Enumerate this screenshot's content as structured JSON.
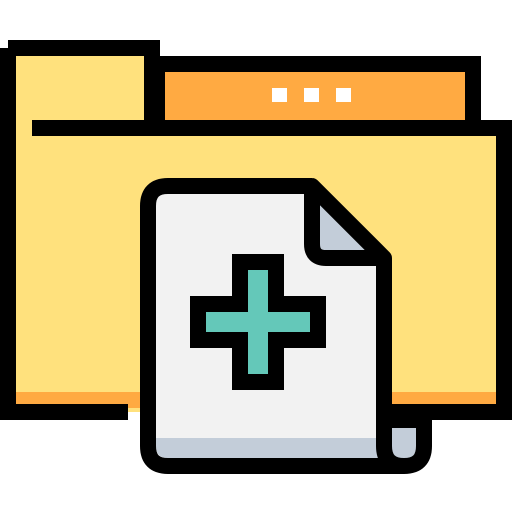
{
  "icon": {
    "name": "add-file-to-folder-icon",
    "depicts": [
      "folder-icon",
      "document-icon",
      "plus-icon"
    ]
  },
  "colors": {
    "outline": "#000000",
    "folder_front": "#FFE17D",
    "folder_back": "#FFAA42",
    "folder_shadow": "#FFAA42",
    "paper": "#F2F2F2",
    "paper_fold": "#C3CDD9",
    "paper_shadow": "#C3CDD9",
    "plus": "#64C8B9",
    "tab_dots": "#FFFFFF",
    "background": "#FFFFFF"
  }
}
